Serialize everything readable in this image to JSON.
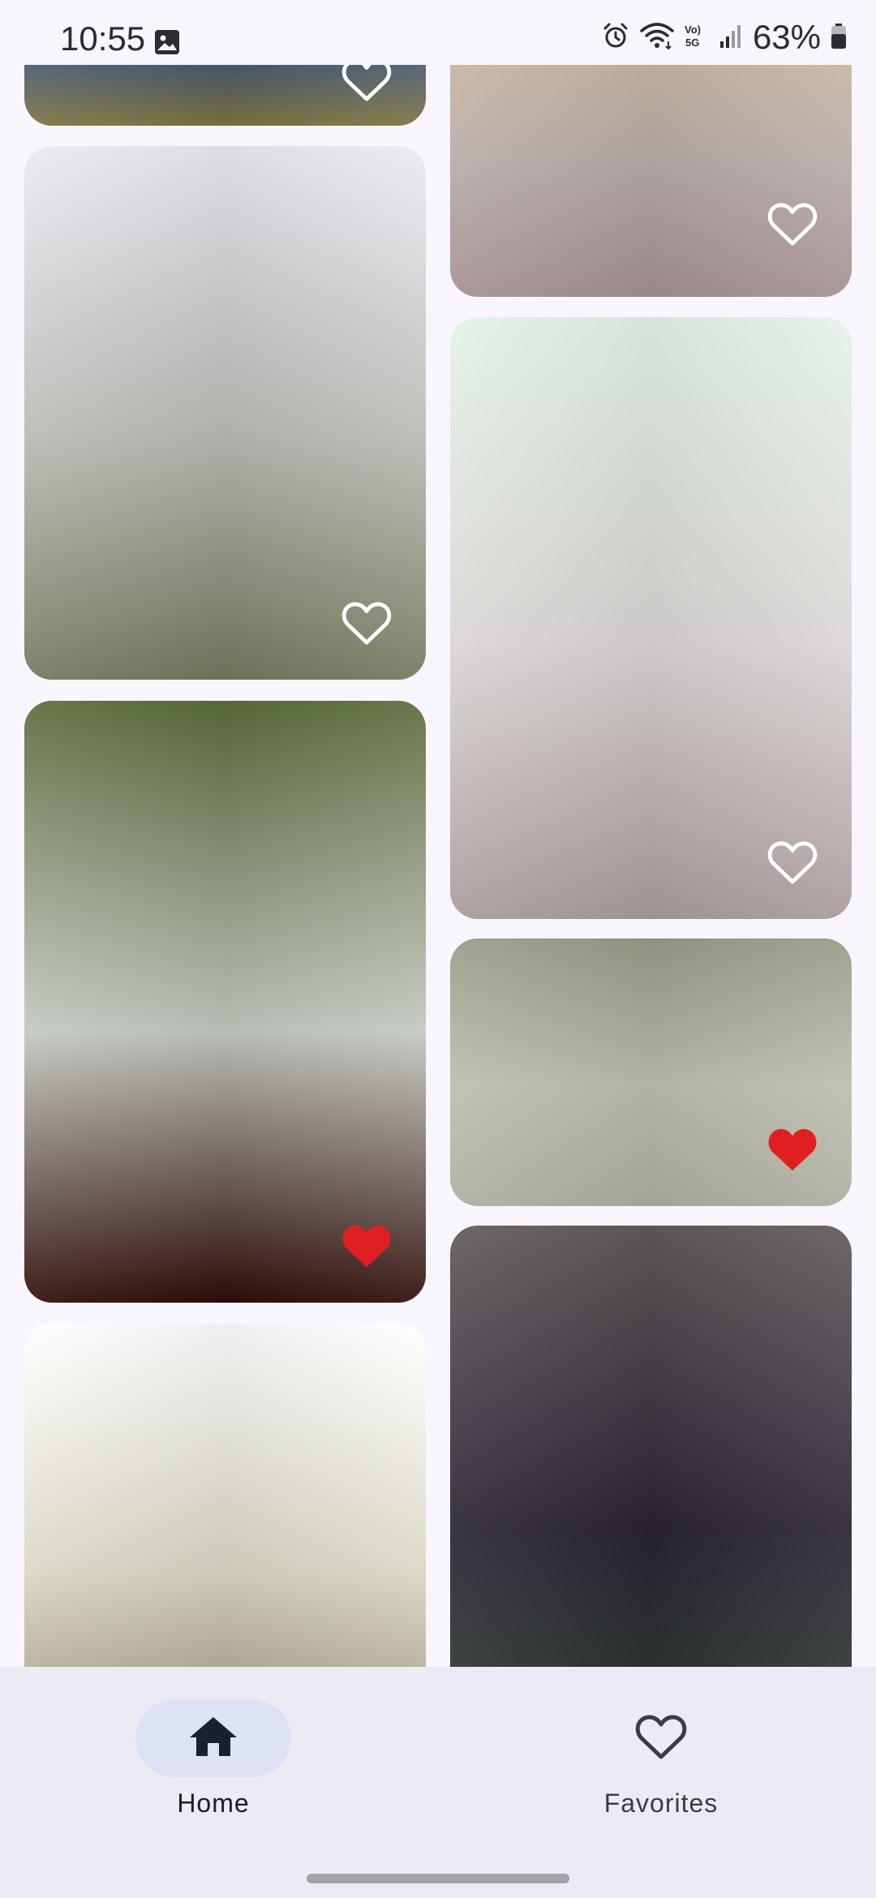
{
  "status_bar": {
    "time": "10:55",
    "battery": "63%",
    "icons": [
      "image-icon",
      "alarm-icon",
      "wifi-icon",
      "volte-5g-icon",
      "signal-icon",
      "battery-icon"
    ]
  },
  "feed": {
    "cards": [
      {
        "id": "c1",
        "favorite": false,
        "colors": [
          "#6c7480",
          "#4c5a6d",
          "#7d7540"
        ]
      },
      {
        "id": "c2",
        "favorite": false,
        "colors": [
          "#eceaf2",
          "#b9b9b4",
          "#76775d"
        ]
      },
      {
        "id": "c3",
        "favorite": true,
        "colors": [
          "#5c6b3c",
          "#c3c8c0",
          "#2e0c08"
        ]
      },
      {
        "id": "c4",
        "favorite": false,
        "colors": [
          "#ffffff",
          "#d9d6c4",
          "#8d8370"
        ]
      },
      {
        "id": "c5",
        "favorite": false,
        "colors": [
          "#d7bb9b",
          "#b6aca8",
          "#a49090"
        ]
      },
      {
        "id": "c6",
        "favorite": false,
        "colors": [
          "#e4f2e6",
          "#d9d5d4",
          "#a89b9a"
        ]
      },
      {
        "id": "c7",
        "favorite": true,
        "colors": [
          "#9a9a88",
          "#bdbdaf",
          "#aeae9f"
        ]
      },
      {
        "id": "c8",
        "favorite": false,
        "colors": [
          "#615b5c",
          "#2a2433",
          "#30402f"
        ]
      }
    ],
    "heart_color_favorite": "#e02020",
    "heart_color_default": "#ffffff"
  },
  "bottom_nav": {
    "items": [
      {
        "label": "Home",
        "icon": "home-icon",
        "selected": true
      },
      {
        "label": "Favorites",
        "icon": "heart-outline-icon",
        "selected": false
      }
    ]
  }
}
